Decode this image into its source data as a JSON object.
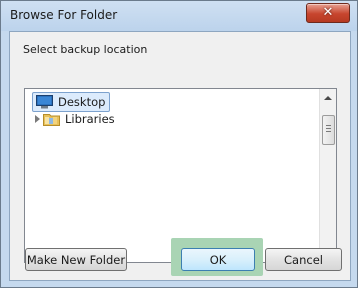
{
  "window": {
    "title": "Browse For Folder",
    "close_label": "✕"
  },
  "instruction": "Select backup location",
  "tree": {
    "items": [
      {
        "label": "Desktop",
        "icon": "desktop-icon",
        "selected": true,
        "expandable": false
      },
      {
        "label": "Libraries",
        "icon": "libraries-folder-icon",
        "selected": false,
        "expandable": true
      }
    ]
  },
  "buttons": {
    "make_new_folder": "Make New Folder",
    "ok": "OK",
    "cancel": "Cancel"
  },
  "colors": {
    "title_bar": "#c5d9ee",
    "close_button": "#c7452e",
    "selection": "#dcebfc",
    "ok_focus_highlight": "#a9d4b4"
  }
}
